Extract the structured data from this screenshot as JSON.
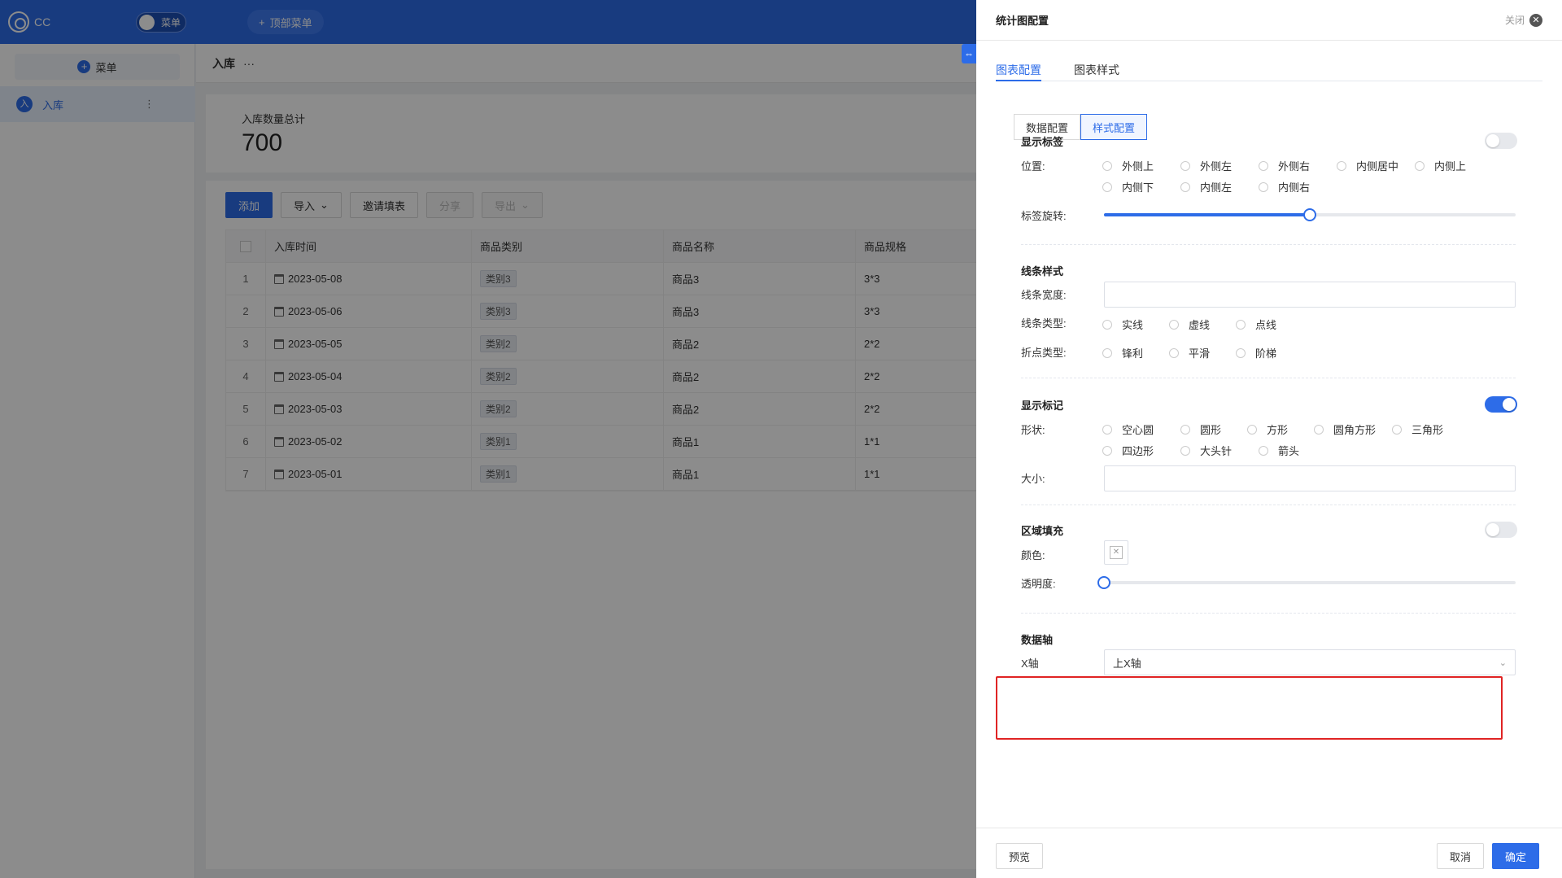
{
  "app": {
    "logo_text": "CC",
    "menu_toggle_label": "菜单",
    "top_menu_label": "顶部菜单",
    "add_menu_label": "菜单",
    "sidebar_item": "入库",
    "sidebar_item_avatar": "入",
    "page_title": "入库",
    "page_more": "···"
  },
  "stat": {
    "label": "入库数量总计",
    "value": "700"
  },
  "toolbar": {
    "add": "添加",
    "import": "导入",
    "invite": "邀请填表",
    "share": "分享",
    "export": "导出"
  },
  "table": {
    "columns": [
      "入库时间",
      "商品类别",
      "商品名称",
      "商品规格"
    ],
    "rows": [
      {
        "no": "1",
        "date": "2023-05-08",
        "category": "类别3",
        "name": "商品3",
        "spec": "3*3"
      },
      {
        "no": "2",
        "date": "2023-05-06",
        "category": "类别3",
        "name": "商品3",
        "spec": "3*3"
      },
      {
        "no": "3",
        "date": "2023-05-05",
        "category": "类别2",
        "name": "商品2",
        "spec": "2*2"
      },
      {
        "no": "4",
        "date": "2023-05-04",
        "category": "类别2",
        "name": "商品2",
        "spec": "2*2"
      },
      {
        "no": "5",
        "date": "2023-05-03",
        "category": "类别2",
        "name": "商品2",
        "spec": "2*2"
      },
      {
        "no": "6",
        "date": "2023-05-02",
        "category": "类别1",
        "name": "商品1",
        "spec": "1*1"
      },
      {
        "no": "7",
        "date": "2023-05-01",
        "category": "类别1",
        "name": "商品1",
        "spec": "1*1"
      }
    ]
  },
  "drawer": {
    "title": "统计图配置",
    "close_label": "关闭",
    "tabs": [
      "图表配置",
      "图表样式"
    ],
    "segments": [
      "数据配置",
      "样式配置"
    ],
    "show_label": {
      "title": "显示标签",
      "enabled": false,
      "position_label": "位置:",
      "positions_row1": [
        "外侧上",
        "外侧左",
        "外侧右",
        "内侧居中",
        "内侧上"
      ],
      "positions_row2": [
        "内侧下",
        "内侧左",
        "内侧右"
      ],
      "rotate_label": "标签旋转:",
      "rotate_fraction": 0.5
    },
    "line_style": {
      "title": "线条样式",
      "width_label": "线条宽度:",
      "width_value": "",
      "type_label": "线条类型:",
      "types": [
        "实线",
        "虚线",
        "点线"
      ],
      "point_label": "折点类型:",
      "points": [
        "锋利",
        "平滑",
        "阶梯"
      ]
    },
    "show_marker": {
      "title": "显示标记",
      "enabled": true,
      "shape_label": "形状:",
      "shapes_row1": [
        "空心圆",
        "圆形",
        "方形",
        "圆角方形",
        "三角形"
      ],
      "shapes_row2": [
        "四边形",
        "大头针",
        "箭头"
      ],
      "size_label": "大小:",
      "size_value": ""
    },
    "area_fill": {
      "title": "区域填充",
      "enabled": false,
      "color_label": "颜色:",
      "opacity_label": "透明度:",
      "opacity_fraction": 0
    },
    "data_axis": {
      "title": "数据轴",
      "x_label": "X轴",
      "x_value": "上X轴"
    },
    "footer": {
      "preview": "预览",
      "cancel": "取消",
      "confirm": "确定"
    }
  },
  "colors": {
    "primary": "#2d6ce8",
    "highlight": "#e02424"
  }
}
